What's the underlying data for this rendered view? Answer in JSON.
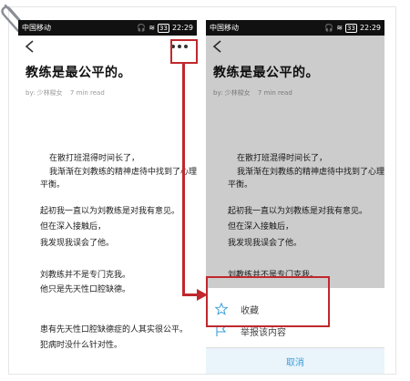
{
  "left": {
    "status": {
      "carrier": "中国移动",
      "time": "22:29",
      "battery": "33"
    },
    "title": "教练是最公平的。",
    "meta": {
      "author": "by: 少林樑女",
      "read_time": "7 min read"
    },
    "paragraphs": [
      "在散打班混得时间长了，",
      "我渐渐在刘教练的精神虐待中找到了心理",
      "平衡。",
      "起初我一直以为刘教练是对我有意见。",
      "但在深入接触后，",
      "我发现我误会了他。",
      "刘教练并不是专门克我。",
      "他只是先天性口腔缺德。",
      "患有先天性口腔缺德症的人其实很公平。",
      "犯病时没什么针对性。"
    ]
  },
  "right": {
    "status": {
      "carrier": "中国移动",
      "time": "22:29",
      "battery": "33"
    },
    "title": "教练是最公平的。",
    "meta": {
      "author": "by: 少林樑女",
      "read_time": "7 min read"
    },
    "paragraphs": [
      "在散打班混得时间长了，",
      "我渐渐在刘教练的精神虐待中找到了心理",
      "平衡。",
      "起初我一直以为刘教练是对我有意见。",
      "但在深入接触后，",
      "我发现我误会了他。",
      "刘教练并不是专门克我。"
    ],
    "menu": {
      "favorite": "收藏",
      "report": "举报该内容",
      "cancel": "取消"
    }
  },
  "colors": {
    "accent": "#3aa0d8",
    "annotation": "#c0282d"
  },
  "icons": [
    "back-icon",
    "more-icon",
    "star-icon",
    "flag-icon",
    "paperclip-icon"
  ]
}
